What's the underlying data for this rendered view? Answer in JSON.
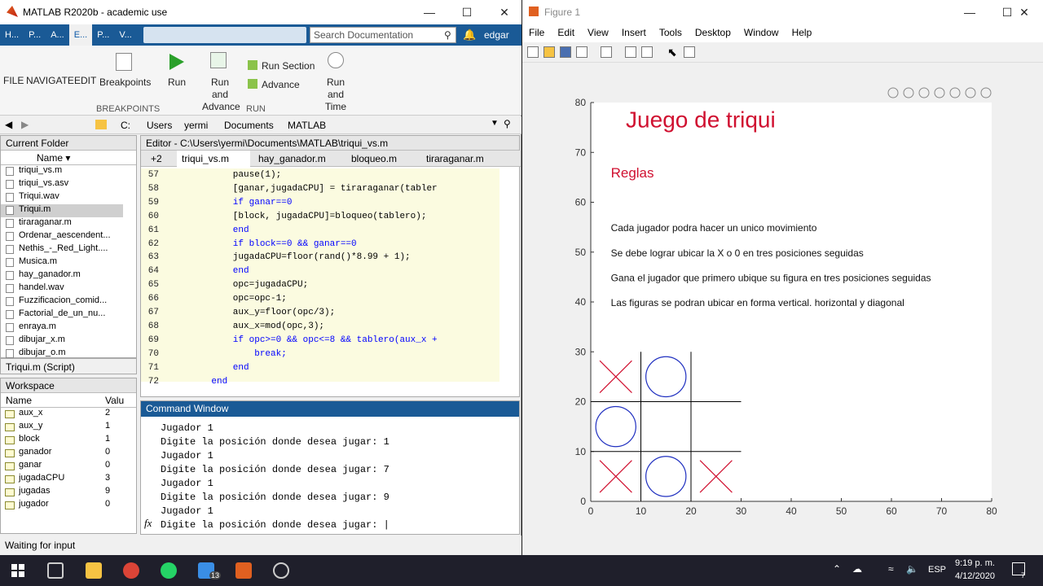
{
  "matlab": {
    "title": "MATLAB R2020b - academic use",
    "tabs": [
      "H...",
      "P...",
      "A...",
      "E...",
      "P...",
      "V..."
    ],
    "search_placeholder": "Search Documentation",
    "user": "edgar",
    "ribbon": {
      "file": "FILE",
      "navigate": "NAVIGATE",
      "edit": "EDIT",
      "breakpoints": "Breakpoints",
      "breakpoints_group": "BREAKPOINTS",
      "run": "Run",
      "run_advance": "Run and Advance",
      "run_section": "Run Section",
      "advance": "Advance",
      "run_time": "Run and Time",
      "run_group": "RUN"
    },
    "path": [
      "C:",
      "Users",
      "yermi",
      "Documents",
      "MATLAB"
    ],
    "current_folder": {
      "title": "Current Folder",
      "col_name": "Name",
      "files": [
        "triqui_vs.m",
        "triqui_vs.asv",
        "Triqui.wav",
        "Triqui.m",
        "tiraraganar.m",
        "Ordenar_aescendent...",
        "Nethis_-_Red_Light....",
        "Musica.m",
        "hay_ganador.m",
        "handel.wav",
        "Fuzzificacion_comid...",
        "Factorial_de_un_nu...",
        "enraya.m",
        "dibujar_x.m",
        "dibujar_o.m"
      ],
      "detail": "Triqui.m  (Script)"
    },
    "workspace": {
      "title": "Workspace",
      "col_name": "Name",
      "col_value": "Valu",
      "vars": [
        {
          "name": "aux_x",
          "value": "2"
        },
        {
          "name": "aux_y",
          "value": "1"
        },
        {
          "name": "block",
          "value": "1"
        },
        {
          "name": "ganador",
          "value": "0"
        },
        {
          "name": "ganar",
          "value": "0"
        },
        {
          "name": "jugadaCPU",
          "value": "3"
        },
        {
          "name": "jugadas",
          "value": "9"
        },
        {
          "name": "jugador",
          "value": "0"
        }
      ]
    },
    "editor": {
      "title": "Editor - C:\\Users\\yermi\\Documents\\MATLAB\\triqui_vs.m",
      "tabs": [
        "+2",
        "triqui_vs.m",
        "hay_ganador.m",
        "bloqueo.m",
        "tiraraganar.m"
      ],
      "lines": [
        {
          "n": "57",
          "code": "        pause(1);"
        },
        {
          "n": "58",
          "code": "        [ganar,jugadaCPU] = tiraraganar(tabler"
        },
        {
          "n": "59",
          "code": "        if ganar==0"
        },
        {
          "n": "60",
          "code": "        [block, jugadaCPU]=bloqueo(tablero);"
        },
        {
          "n": "61",
          "code": "        end"
        },
        {
          "n": "62",
          "code": "        if block==0 && ganar==0"
        },
        {
          "n": "63",
          "code": "        jugadaCPU=floor(rand()*8.99 + 1);"
        },
        {
          "n": "64",
          "code": "        end"
        },
        {
          "n": "65",
          "code": "        opc=jugadaCPU;"
        },
        {
          "n": "66",
          "code": "        opc=opc-1;"
        },
        {
          "n": "67",
          "code": "        aux_y=floor(opc/3);"
        },
        {
          "n": "68",
          "code": "        aux_x=mod(opc,3);"
        },
        {
          "n": "69",
          "code": "        if opc>=0 && opc<=8 && tablero(aux_x +"
        },
        {
          "n": "70",
          "code": "            break;"
        },
        {
          "n": "71",
          "code": "        end"
        },
        {
          "n": "72",
          "code": "    end"
        }
      ]
    },
    "command_window": {
      "title": "Command Window",
      "lines": [
        "Jugador 1",
        "Digite la posición donde desea jugar: 1",
        "Jugador 1",
        "Digite la posición donde desea jugar: 7",
        "Jugador 1",
        "Digite la posición donde desea jugar: 9",
        "Jugador 1",
        "Digite la posición donde desea jugar: |"
      ],
      "fx": "fx"
    },
    "status": "Waiting for input"
  },
  "figure": {
    "title": "Figure 1",
    "menu": [
      "File",
      "Edit",
      "View",
      "Insert",
      "Tools",
      "Desktop",
      "Window",
      "Help"
    ],
    "heading": "Juego de triqui",
    "subheading": "Reglas",
    "rules": [
      "Cada jugador podra hacer un unico movimiento",
      "Se debe lograr ubicar la X o 0 en tres posiciones seguidas",
      "Gana el jugador que primero ubique su figura en tres posiciones seguidas",
      "Las figuras se podran ubicar en forma vertical. horizontal y diagonal"
    ],
    "board": [
      [
        "X",
        "O",
        ""
      ],
      [
        "O",
        "",
        ""
      ],
      [
        "X",
        "O",
        "X"
      ]
    ],
    "x_color": "#d01030",
    "o_color": "#2030c0",
    "title_color": "#d01030"
  },
  "chart_data": {
    "type": "scatter",
    "xlim": [
      0,
      80
    ],
    "ylim": [
      0,
      80
    ],
    "x_ticks": [
      0,
      10,
      20,
      30,
      40,
      50,
      60,
      70,
      80
    ],
    "y_ticks": [
      0,
      10,
      20,
      30,
      40,
      50,
      60,
      70,
      80
    ],
    "grid_lines": {
      "vertical_x": [
        10,
        20
      ],
      "horizontal_y": [
        10,
        20
      ],
      "extent": [
        0,
        30
      ]
    }
  },
  "taskbar": {
    "time": "9:19 p. m.",
    "date": "4/12/2020",
    "lang": "ESP",
    "badge": "13",
    "notif": "7"
  }
}
